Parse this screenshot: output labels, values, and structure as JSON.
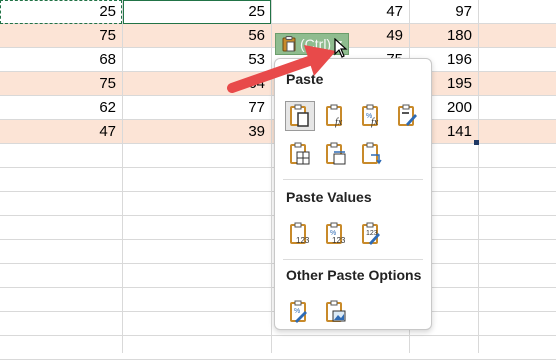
{
  "grid": {
    "rows": [
      [
        "25",
        "25",
        "",
        "47",
        "97"
      ],
      [
        "75",
        "56",
        "",
        "49",
        "180"
      ],
      [
        "68",
        "53",
        "",
        "75",
        "196"
      ],
      [
        "75",
        "64",
        "",
        "",
        "195"
      ],
      [
        "62",
        "77",
        "",
        "",
        "200"
      ],
      [
        "47",
        "39",
        "",
        "",
        "141"
      ]
    ]
  },
  "paste_options_tag": {
    "label": "(Ctrl)"
  },
  "menu": {
    "paste_title": "Paste",
    "paste_values_title": "Paste Values",
    "other_title": "Other Paste Options",
    "paste_icons": [
      "paste-icon",
      "paste-formulas-icon",
      "paste-formulas-number-formatting-icon",
      "paste-keep-source-formatting-icon",
      "paste-no-borders-icon",
      "paste-keep-column-widths-icon",
      "paste-transpose-icon"
    ],
    "paste_values_icons": [
      "paste-values-icon",
      "paste-values-number-formatting-icon",
      "paste-values-source-formatting-icon"
    ],
    "other_icons": [
      "paste-formatting-icon",
      "paste-picture-icon"
    ]
  },
  "colors": {
    "band": "#fce4d6",
    "selection": "#217346",
    "arrow": "#e84a4a",
    "clipboard": "#c88a2a"
  }
}
